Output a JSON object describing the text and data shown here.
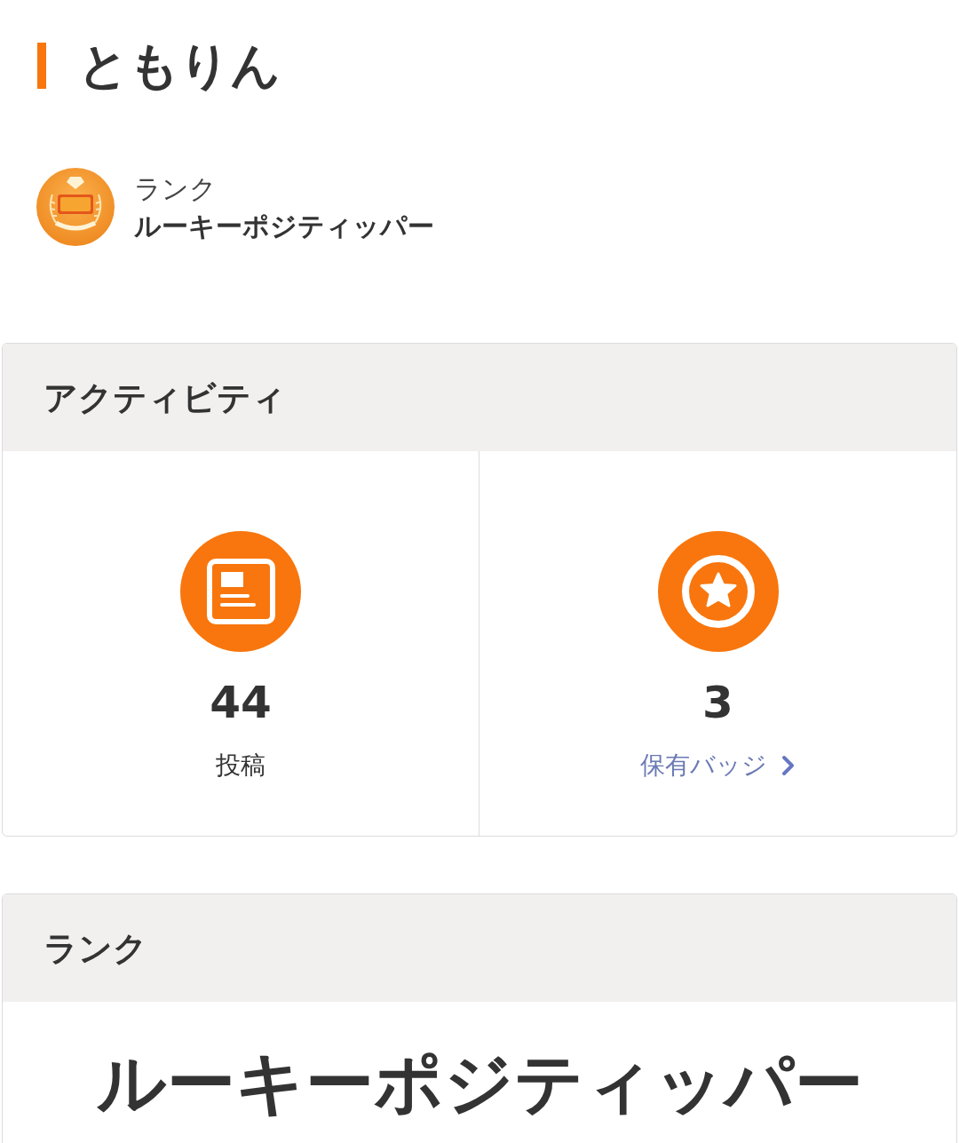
{
  "profile": {
    "name": "ともりん",
    "rank_label": "ランク",
    "rank_name": "ルーキーポジティッパー"
  },
  "activity": {
    "title": "アクティビティ",
    "stats": [
      {
        "kind": "posts",
        "value": "44",
        "label": "投稿"
      },
      {
        "kind": "badges",
        "value": "3",
        "label": "保有バッジ"
      }
    ]
  },
  "rank_section": {
    "title": "ランク",
    "rank_name": "ルーキーポジティッパー"
  }
}
